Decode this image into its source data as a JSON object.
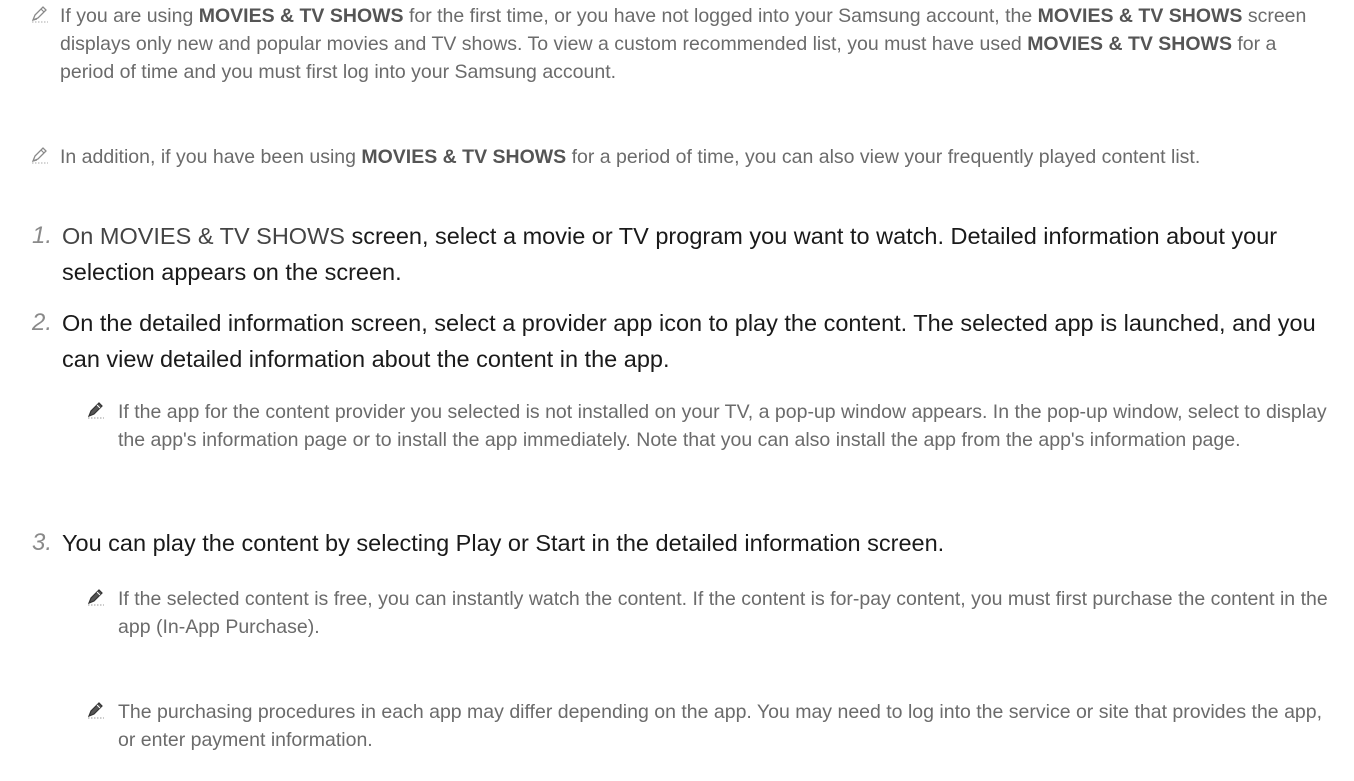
{
  "notes": {
    "n1": {
      "t1": "If you are using ",
      "b1": "MOVIES & TV SHOWS",
      "t2": " for the first time, or you have not logged into your Samsung account, the ",
      "b2": "MOVIES & TV SHOWS",
      "t3": " screen displays only new and popular movies and TV shows. To view a custom recommended list, you must have used ",
      "b3": "MOVIES & TV SHOWS",
      "t4": " for a period of time and you must first log into your Samsung account."
    },
    "n2": {
      "t1": "In addition, if you have been using ",
      "b1": "MOVIES & TV SHOWS",
      "t2": " for a period of time, you can also view your frequently played content list."
    }
  },
  "steps": {
    "s1": {
      "num": "1.",
      "b1": "On MOVIES & TV SHOWS",
      "t1": " screen, select a movie or TV program you want to watch. Detailed information about your selection appears on the screen."
    },
    "s2": {
      "num": "2.",
      "text": "On the detailed information screen, select a provider app icon to play the content. The selected app is launched, and you can view detailed information about the content in the app.",
      "note": "If the app for the content provider you selected is not installed on your TV, a pop-up window appears. In the pop-up window, select to display the app's information page or to install the app immediately. Note that you can also install the app from the app's information page."
    },
    "s3": {
      "num": "3.",
      "text": "You can play the content by selecting Play or Start in the detailed information screen.",
      "note1": "If the selected content is free, you can instantly watch the content. If the content is for-pay content, you must first purchase the content in the app (In-App Purchase).",
      "note2": "The purchasing procedures in each app may differ depending on the app. You may need to log into the service or site that provides the app, or enter payment information."
    }
  },
  "icons": {
    "note": "pencil-icon"
  }
}
